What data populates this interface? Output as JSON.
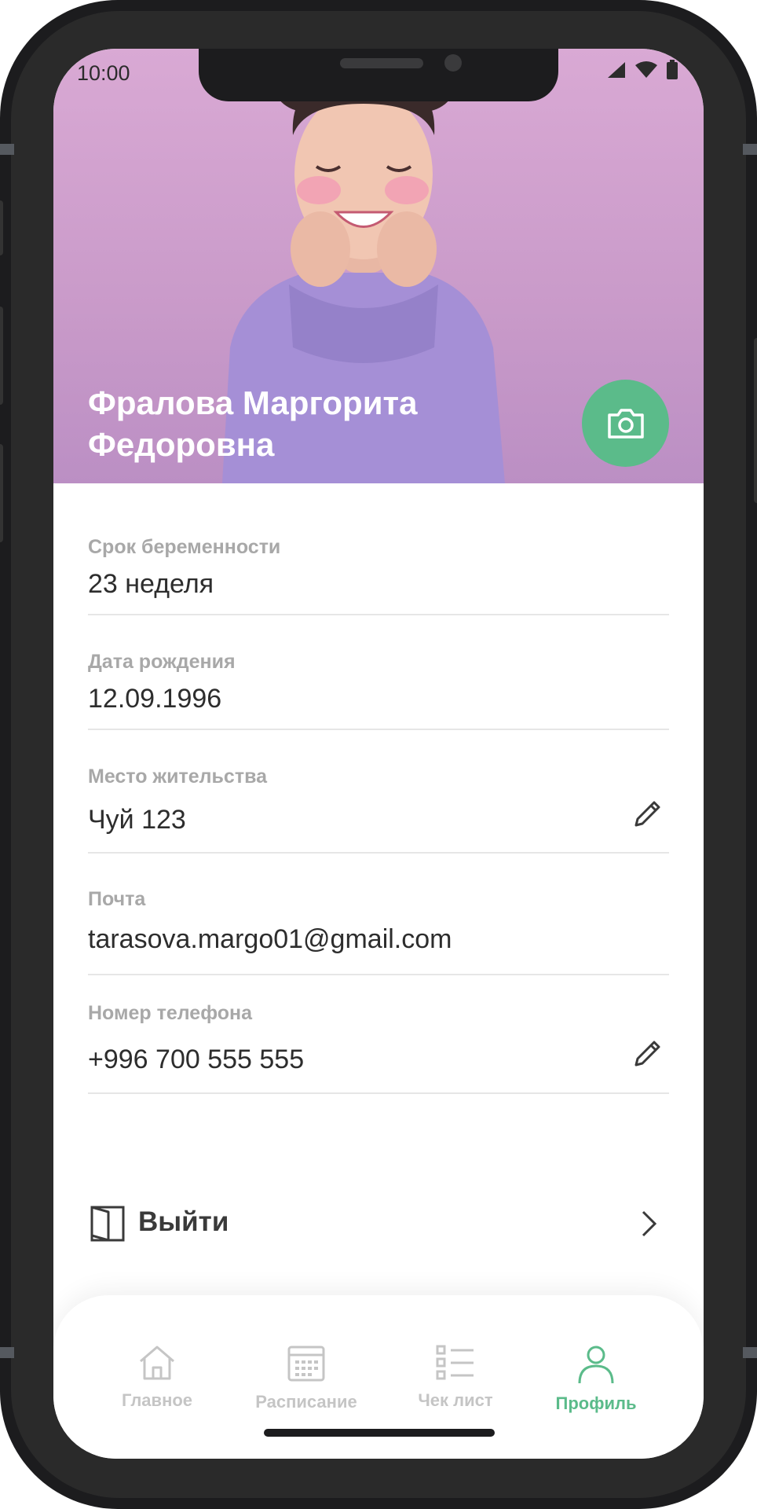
{
  "status_bar": {
    "time": "10:00"
  },
  "profile": {
    "name_line1": "Фралова Маргорита",
    "name_line2": "Федоровна"
  },
  "fields": [
    {
      "label": "Срок беременности",
      "value": "23  неделя",
      "editable": false
    },
    {
      "label": "Дата рождения",
      "value": "12.09.1996",
      "editable": false
    },
    {
      "label": "Место жительства",
      "value": "Чуй 123",
      "editable": true
    },
    {
      "label": "Почта",
      "value": "tarasova.margo01@gmail.com",
      "editable": false
    },
    {
      "label": "Номер телефона",
      "value": "+996 700 555 555",
      "editable": true
    }
  ],
  "logout": {
    "label": "Выйти"
  },
  "tabs": [
    {
      "label": "Главное",
      "icon": "home-icon",
      "active": false
    },
    {
      "label": "Расписание",
      "icon": "calendar-icon",
      "active": false
    },
    {
      "label": "Чек лист",
      "icon": "checklist-icon",
      "active": false
    },
    {
      "label": "Профиль",
      "icon": "profile-icon",
      "active": true
    }
  ],
  "colors": {
    "accent": "#5bbb8a",
    "hero": "#d9a9d4",
    "label": "#a8a8a8",
    "text": "#2d2d2d"
  }
}
